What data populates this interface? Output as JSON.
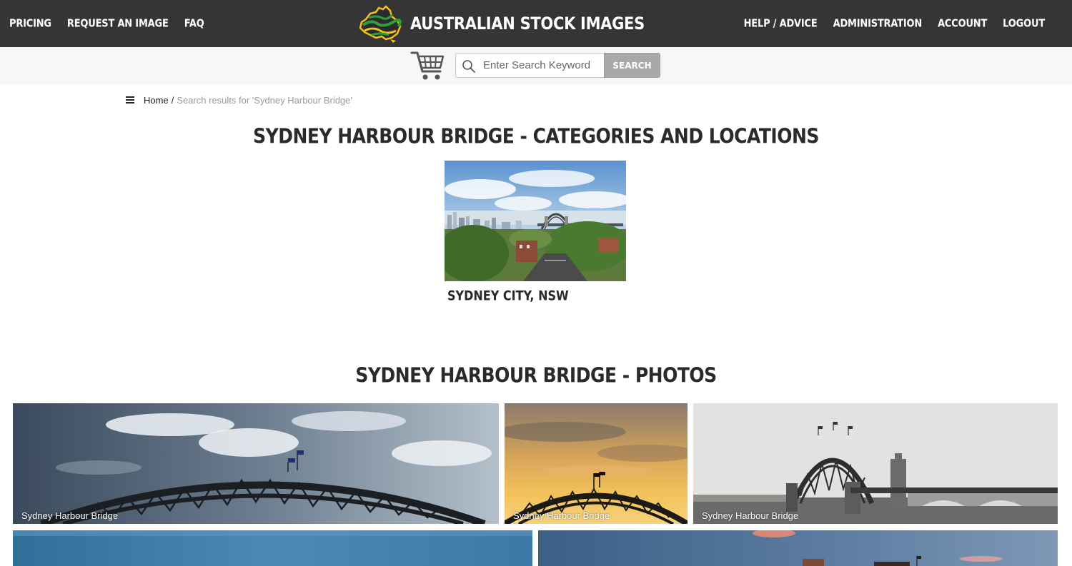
{
  "nav": {
    "left": [
      "PRICING",
      "REQUEST AN IMAGE",
      "FAQ"
    ],
    "right": [
      "HELP / ADVICE",
      "ADMINISTRATION",
      "ACCOUNT",
      "LOGOUT"
    ],
    "brand": "AUSTRALIAN STOCK IMAGES"
  },
  "search": {
    "placeholder": "Enter Search Keyword",
    "button": "SEARCH"
  },
  "breadcrumb": {
    "home": "Home",
    "separator": "/",
    "current": "Search results for 'Sydney Harbour Bridge'"
  },
  "categories": {
    "title": "SYDNEY HARBOUR BRIDGE - CATEGORIES AND LOCATIONS",
    "items": [
      {
        "label": "SYDNEY CITY, NSW"
      }
    ]
  },
  "photos": {
    "title": "SYDNEY HARBOUR BRIDGE - PHOTOS",
    "items": [
      {
        "caption": "Sydney Harbour Bridge"
      },
      {
        "caption": "Sydney Harbour Bridge"
      },
      {
        "caption": "Sydney Harbour Bridge"
      },
      {
        "caption": ""
      },
      {
        "caption": ""
      }
    ]
  },
  "colors": {
    "topbar": "#353535",
    "search_strip": "#f8f7f5",
    "search_button": "#a9a9a9",
    "logo_green": "#2e9d3a",
    "logo_gold": "#f2c21a"
  },
  "icons": [
    "australia-logo-icon",
    "shopping-cart-icon",
    "search-icon",
    "hamburger-menu-icon"
  ]
}
